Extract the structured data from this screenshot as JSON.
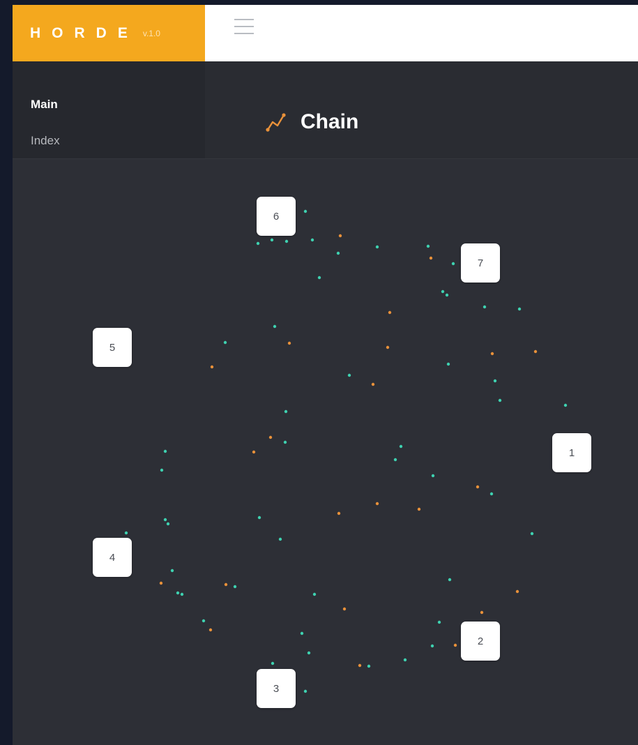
{
  "brand": {
    "name": "HORDE",
    "version": "v.1.0"
  },
  "topbar": {
    "menu_icon": "hamburger-icon"
  },
  "sidebar": {
    "items": [
      {
        "label": "Main"
      },
      {
        "label": "Index"
      }
    ]
  },
  "header": {
    "title": "Chain",
    "icon": "line-chart-icon",
    "icon_color": "#e8913a"
  },
  "colors": {
    "brand": "#f4a81e",
    "teal_dot": "#3ed1b0",
    "orange_dot": "#e8913a"
  },
  "graph": {
    "nodes": [
      {
        "label": "1"
      },
      {
        "label": "2"
      },
      {
        "label": "3"
      },
      {
        "label": "4"
      },
      {
        "label": "5"
      },
      {
        "label": "6"
      },
      {
        "label": "7"
      }
    ]
  }
}
